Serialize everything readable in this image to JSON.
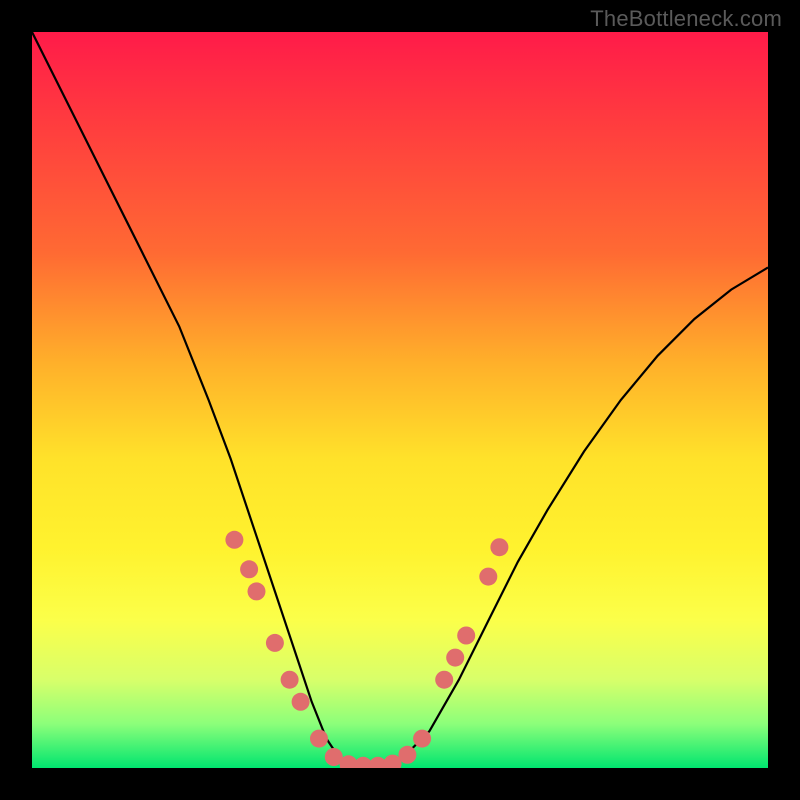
{
  "watermark": "TheBottleneck.com",
  "colors": {
    "gradient_top": "#ff1b49",
    "gradient_bottom": "#00e56f",
    "frame": "#000000",
    "curve": "#000000",
    "dot": "#e06d6d"
  },
  "chart_data": {
    "type": "line",
    "title": "",
    "xlabel": "",
    "ylabel": "",
    "xlim": [
      0,
      100
    ],
    "ylim": [
      0,
      100
    ],
    "annotations": [
      "TheBottleneck.com"
    ],
    "series": [
      {
        "name": "bottleneck-curve",
        "x": [
          0,
          5,
          10,
          15,
          20,
          24,
          27,
          30,
          33,
          36,
          38,
          40,
          42,
          44,
          46,
          48,
          50,
          54,
          58,
          62,
          66,
          70,
          75,
          80,
          85,
          90,
          95,
          100
        ],
        "y": [
          100,
          90,
          80,
          70,
          60,
          50,
          42,
          33,
          24,
          15,
          9,
          4,
          1,
          0,
          0,
          0,
          1,
          5,
          12,
          20,
          28,
          35,
          43,
          50,
          56,
          61,
          65,
          68
        ]
      }
    ],
    "markers": [
      {
        "x": 27.5,
        "y": 31
      },
      {
        "x": 29.5,
        "y": 27
      },
      {
        "x": 30.5,
        "y": 24
      },
      {
        "x": 33.0,
        "y": 17
      },
      {
        "x": 35.0,
        "y": 12
      },
      {
        "x": 36.5,
        "y": 9
      },
      {
        "x": 39.0,
        "y": 4
      },
      {
        "x": 41.0,
        "y": 1.5
      },
      {
        "x": 43.0,
        "y": 0.5
      },
      {
        "x": 45.0,
        "y": 0.3
      },
      {
        "x": 47.0,
        "y": 0.3
      },
      {
        "x": 49.0,
        "y": 0.6
      },
      {
        "x": 51.0,
        "y": 1.8
      },
      {
        "x": 53.0,
        "y": 4
      },
      {
        "x": 56.0,
        "y": 12
      },
      {
        "x": 57.5,
        "y": 15
      },
      {
        "x": 59.0,
        "y": 18
      },
      {
        "x": 62.0,
        "y": 26
      },
      {
        "x": 63.5,
        "y": 30
      }
    ]
  }
}
